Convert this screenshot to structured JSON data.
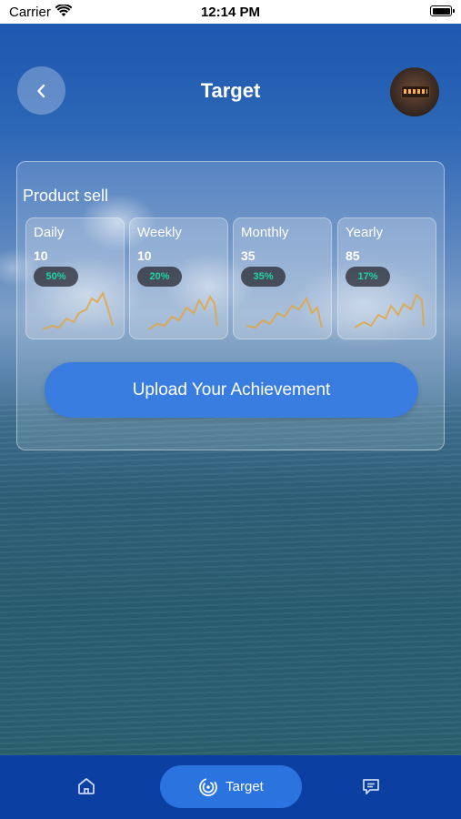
{
  "status_bar": {
    "carrier": "Carrier",
    "time": "12:14 PM"
  },
  "header": {
    "title": "Target"
  },
  "card": {
    "title": "Product sell",
    "stats": [
      {
        "label": "Daily",
        "value": "10",
        "percent": "50%"
      },
      {
        "label": "Weekly",
        "value": "10",
        "percent": "20%"
      },
      {
        "label": "Monthly",
        "value": "35",
        "percent": "35%"
      },
      {
        "label": "Yearly",
        "value": "85",
        "percent": "17%"
      }
    ],
    "upload_label": "Upload Your Achievement"
  },
  "tabbar": {
    "active_label": "Target"
  },
  "colors": {
    "accent": "#3a7de0",
    "tabbar": "#0b3fa2",
    "percent_text": "#22d3a4"
  }
}
